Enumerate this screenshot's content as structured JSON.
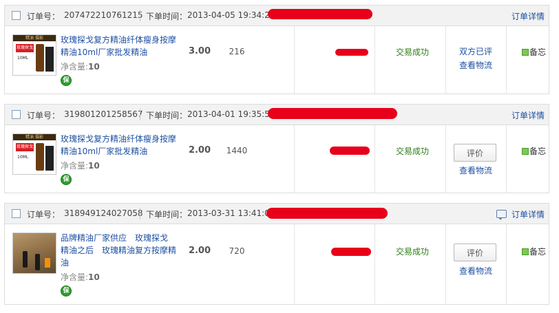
{
  "labels": {
    "order_no": "订单号：",
    "order_time": "下单时间：",
    "order_detail": "订单详情",
    "net_content": "净含量:",
    "status_success": "交易成功",
    "both_rated": "双方已评",
    "view_logistics": "查看物流",
    "evaluate": "评价",
    "memo": "备忘",
    "guarantee_icon_text": "保"
  },
  "orders": [
    {
      "order_no": "207472210761215",
      "order_time": "2013-04-05 19:34:27",
      "product_title": "玫瑰探戈复方精油纤体瘦身按摩精油10ml厂家批发精油",
      "net_content": "10",
      "price": "3.00",
      "quantity": "216",
      "status": "交易成功",
      "action": "双方已评",
      "has_evaluate_button": false,
      "has_message_icon": false,
      "thumb_style": "bottle",
      "thumb_banner": "精油 摄影",
      "thumb_label": "玫瑰探戈",
      "thumb_ml": "10ML"
    },
    {
      "order_no": "319801201258567",
      "order_time": "2013-04-01 19:35:53",
      "product_title": "玫瑰探戈复方精油纤体瘦身按摩精油10ml厂家批发精油",
      "net_content": "10",
      "price": "2.00",
      "quantity": "1440",
      "status": "交易成功",
      "action": "评价",
      "has_evaluate_button": true,
      "has_message_icon": false,
      "thumb_style": "bottle",
      "thumb_banner": "精油 摄影",
      "thumb_label": "玫瑰探戈",
      "thumb_ml": "10ML"
    },
    {
      "order_no": "318949124027058",
      "order_time": "2013-03-31 13:41:05",
      "product_title": "品牌精油厂家供应　玫瑰探戈　精油之后　玫瑰精油复方按摩精油",
      "net_content": "10",
      "price": "2.00",
      "quantity": "720",
      "status": "交易成功",
      "action": "评价",
      "has_evaluate_button": true,
      "has_message_icon": true,
      "thumb_style": "photo"
    }
  ],
  "colors": {
    "link": "#1e50a2",
    "status": "#2e7d14",
    "redaction": "#e8001a",
    "header_bg": "#f2f2f2",
    "border": "#dcdcdc"
  }
}
